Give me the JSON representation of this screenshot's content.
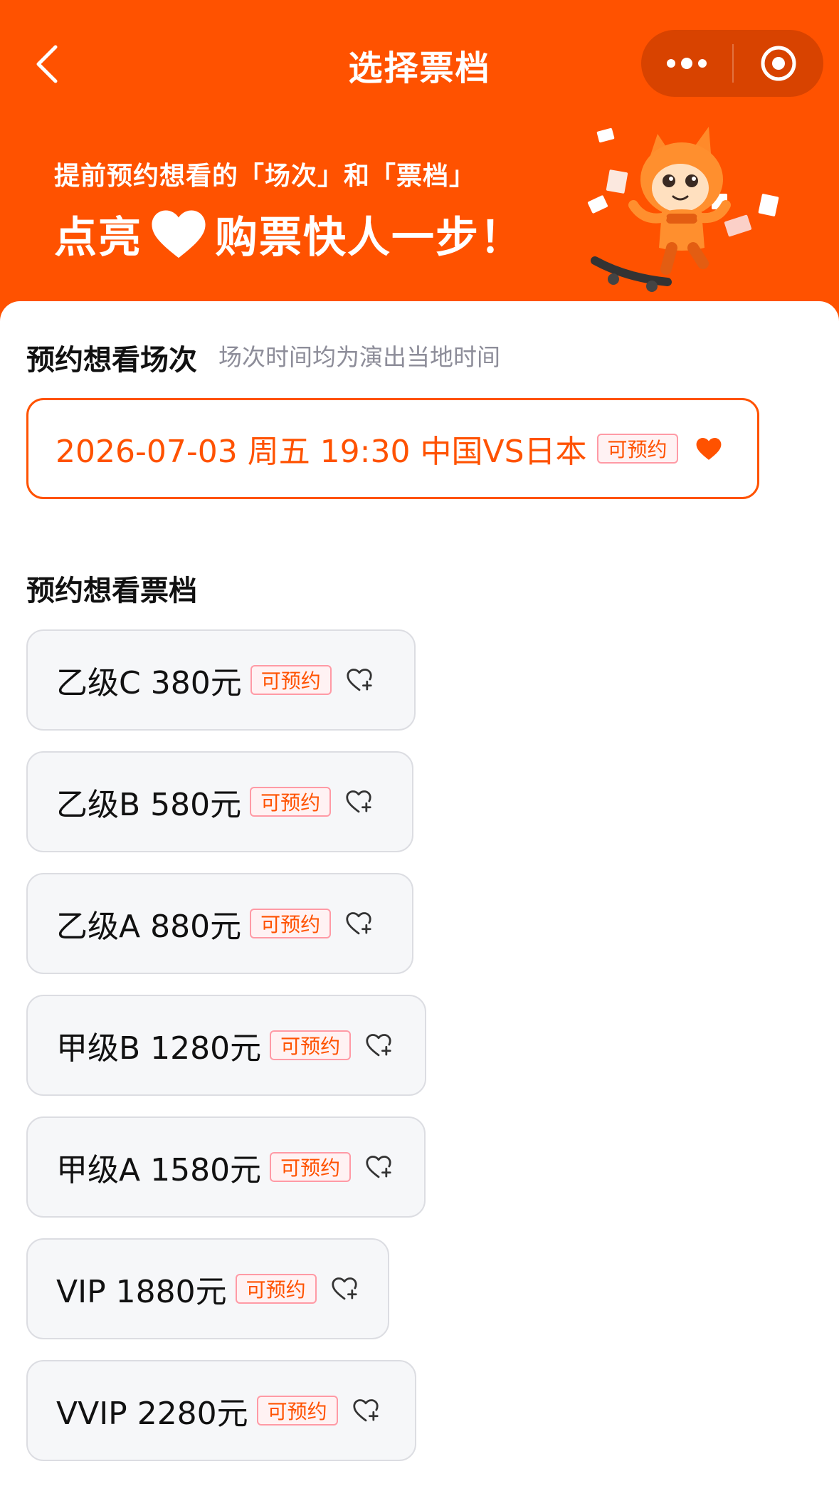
{
  "nav": {
    "title": "选择票档"
  },
  "promo": {
    "line1": "提前预约想看的「场次」和「票档」",
    "line2_before": "点亮",
    "line2_after": "购票快人一步！"
  },
  "session_section": {
    "title": "预约想看场次",
    "hint": "场次时间均为演出当地时间",
    "session": {
      "label": "2026-07-03 周五 19:30 中国VS日本",
      "badge": "可预约"
    }
  },
  "tier_section": {
    "title": "预约想看票档",
    "tiers": [
      {
        "label": "乙级C 380元",
        "badge": "可预约"
      },
      {
        "label": "乙级B 580元",
        "badge": "可预约"
      },
      {
        "label": "乙级A 880元",
        "badge": "可预约"
      },
      {
        "label": "甲级B 1280元",
        "badge": "可预约"
      },
      {
        "label": "甲级A 1580元",
        "badge": "可预约"
      },
      {
        "label": "VIP 1880元",
        "badge": "可预约"
      },
      {
        "label": "VVIP 2280元",
        "badge": "可预约"
      }
    ]
  },
  "colors": {
    "brand": "#ff5200",
    "capsule": "#d84300",
    "badge_border": "#ff9aa5",
    "card_bg": "#f6f7f9"
  },
  "icons": {
    "back": "chevron-left-icon",
    "more": "more-dots-icon",
    "close": "target-circle-icon",
    "wish_filled": "heart-filled-icon",
    "wish_add": "heart-plus-icon"
  }
}
